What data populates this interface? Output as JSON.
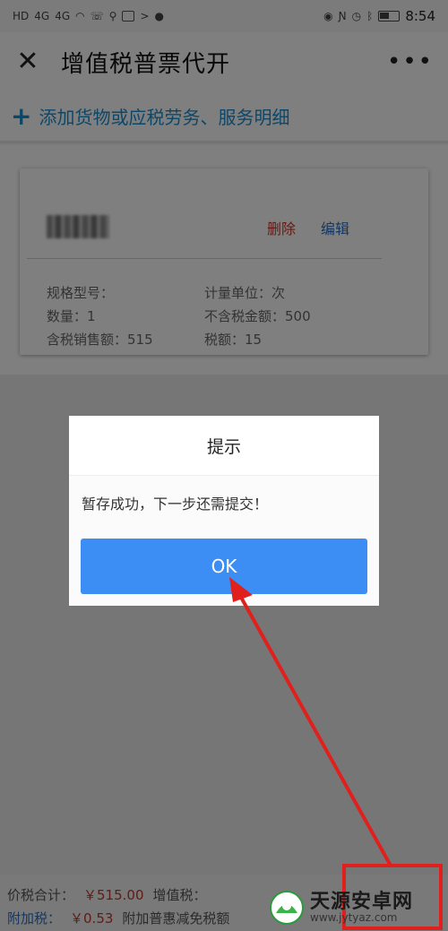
{
  "status_bar": {
    "left_labels": [
      "HD",
      "4G",
      "4G"
    ],
    "time": "8:54"
  },
  "header": {
    "title": "增值税普票代开",
    "close_icon": "close-icon",
    "more_icon": "more-icon"
  },
  "add_item": {
    "label": "添加货物或应税劳务、服务明细"
  },
  "item": {
    "delete_label": "删除",
    "edit_label": "编辑",
    "fields": {
      "spec": "规格型号：",
      "unit": "计量单位：次",
      "quantity": "数量：1",
      "amount_excl_tax": "不含税金额：500",
      "sales_incl_tax": "含税销售额：515",
      "tax": "税额：15"
    }
  },
  "bottom": {
    "total_label": "价税合计：",
    "total_value": "￥515.00",
    "vat_label": "增值税：",
    "surcharge_label": "附加税：",
    "surcharge_value": "￥0.53",
    "relief_label": "附加普惠减免税额"
  },
  "dialog": {
    "title": "提示",
    "message": "暂存成功，下一步还需提交！",
    "ok_label": "OK"
  },
  "watermark": {
    "name": "天源安卓网",
    "url": "www.jytyaz.com"
  },
  "colors": {
    "accent_blue": "#1b8fd0",
    "button_blue": "#3c8ef5",
    "delete_red": "#c0392b",
    "annotation_red": "#e0201c"
  }
}
